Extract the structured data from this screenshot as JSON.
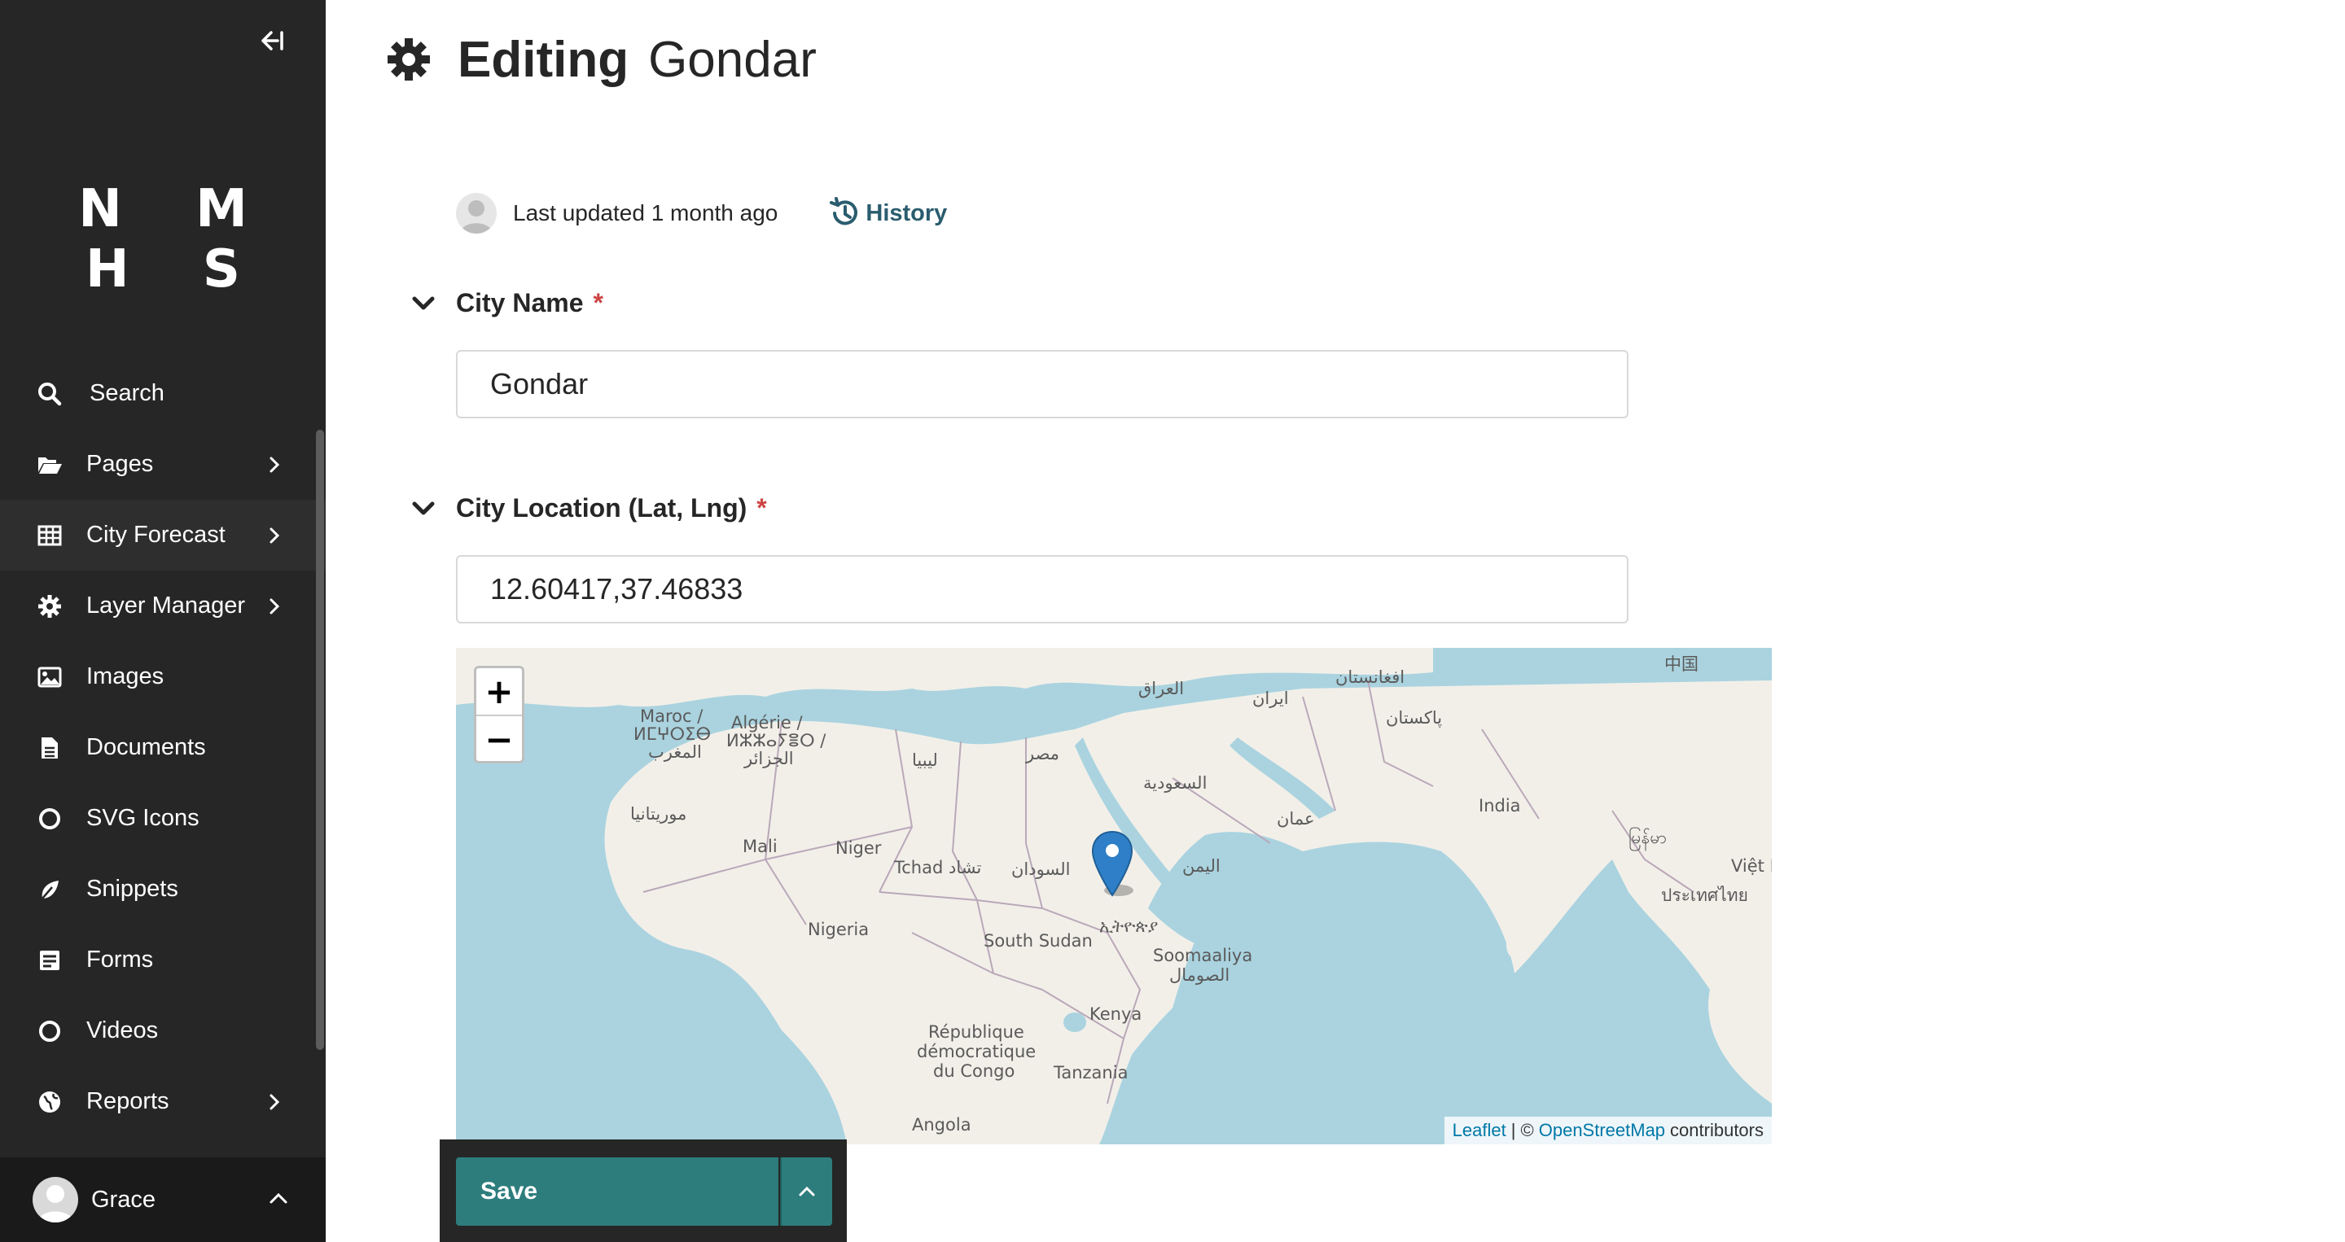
{
  "sidebar": {
    "logo": "N M H S",
    "items": [
      {
        "label": "Search",
        "icon": "search-icon",
        "has_submenu": false
      },
      {
        "label": "Pages",
        "icon": "folder-open-icon",
        "has_submenu": true
      },
      {
        "label": "City Forecast",
        "icon": "table-icon",
        "has_submenu": true
      },
      {
        "label": "Layer Manager",
        "icon": "gear-icon",
        "has_submenu": true
      },
      {
        "label": "Images",
        "icon": "image-icon",
        "has_submenu": false
      },
      {
        "label": "Documents",
        "icon": "document-icon",
        "has_submenu": false
      },
      {
        "label": "SVG Icons",
        "icon": "circle-icon",
        "has_submenu": false
      },
      {
        "label": "Snippets",
        "icon": "snippet-icon",
        "has_submenu": false
      },
      {
        "label": "Forms",
        "icon": "form-icon",
        "has_submenu": false
      },
      {
        "label": "Videos",
        "icon": "circle-icon",
        "has_submenu": false
      },
      {
        "label": "Reports",
        "icon": "globe-icon",
        "has_submenu": true
      }
    ],
    "account_name": "Grace"
  },
  "header": {
    "action": "Editing",
    "object_name": "Gondar"
  },
  "meta": {
    "last_updated": "Last updated 1 month ago",
    "history_label": "History"
  },
  "fields": {
    "city_name": {
      "label": "City Name",
      "required_mark": "*",
      "value": "Gondar"
    },
    "city_location": {
      "label": "City Location (Lat, Lng)",
      "required_mark": "*",
      "value": "12.60417,37.46833"
    }
  },
  "map": {
    "zoom_in": "+",
    "zoom_out": "−",
    "attribution": {
      "leaflet": "Leaflet",
      "separator": "| ©",
      "osm": "OpenStreetMap",
      "suffix": "contributors"
    },
    "labels": {
      "maroc": "Maroc /",
      "maroc_tif": "ⵍⵎⵖⵔⵉⴱ",
      "maroc_ar": "المغرب",
      "algerie": "Algérie /",
      "algerie_tif": "ⵍⵣⵣⴰⵢⴻⵔ /",
      "algerie_ar": "الجزائر",
      "libya": "ليبيا",
      "egypt": "مصر",
      "iraq": "العراق",
      "iran": "ایران",
      "afghanistan": "افغانستان",
      "pakistan": "پاکستان",
      "china": "中国",
      "saudi": "السعودية",
      "oman": "عمان",
      "india": "India",
      "mauritania": "موريتانيا",
      "mali": "Mali",
      "niger": "Niger",
      "chad": "Tchad تشاد",
      "sudan": "السودان",
      "yemen": "اليمن",
      "myanmar": "မြန်မာ",
      "vietnam": "Việt N",
      "thailand": "ประเทศไทย",
      "nigeria": "Nigeria",
      "south_sudan": "South Sudan",
      "ethiopia": "ኢትዮጵያ",
      "somalia": "Soomaaliya",
      "somalia_ar": "الصومال",
      "kenya": "Kenya",
      "drc1": "République",
      "drc2": "démocratique",
      "drc3": "du Congo",
      "tanzania": "Tanzania",
      "angola": "Angola"
    },
    "marker_latlng": [
      12.60417,
      37.46833
    ]
  },
  "footer": {
    "save_label": "Save"
  },
  "colors": {
    "sidebar_bg": "#262626",
    "accent": "#2e7d7d",
    "required": "#cd4444",
    "link": "#2a5c6e",
    "sea": "#aad3df",
    "land": "#f2efe9"
  }
}
